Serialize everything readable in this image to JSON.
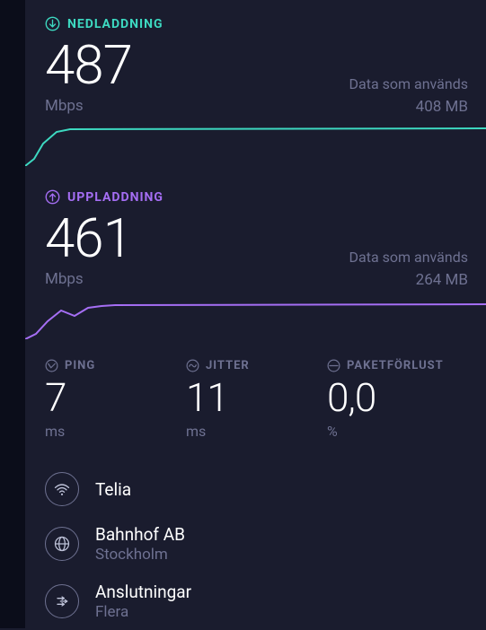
{
  "download": {
    "label": "NEDLADDNING",
    "value": "487",
    "unit": "Mbps",
    "data_used_label": "Data som används",
    "data_used_value": "408 MB"
  },
  "upload": {
    "label": "UPPLADDNING",
    "value": "461",
    "unit": "Mbps",
    "data_used_label": "Data som används",
    "data_used_value": "264 MB"
  },
  "metrics": {
    "ping": {
      "label": "PING",
      "value": "7",
      "unit": "ms"
    },
    "jitter": {
      "label": "JITTER",
      "value": "11",
      "unit": "ms"
    },
    "loss": {
      "label": "PAKETFÖRLUST",
      "value": "0,0",
      "unit": "%"
    }
  },
  "info": {
    "network": {
      "primary": "Telia"
    },
    "isp": {
      "primary": "Bahnhof AB",
      "secondary": "Stockholm"
    },
    "connections": {
      "primary": "Anslutningar",
      "secondary": "Flera"
    }
  },
  "colors": {
    "download": "#3dd9c1",
    "upload": "#a56ef4",
    "muted": "#6e7191"
  },
  "chart_data": [
    {
      "type": "line",
      "title": "Download speed over time",
      "ylabel": "Mbps",
      "ylim": [
        0,
        550
      ],
      "x": [
        0,
        1,
        2,
        3,
        4,
        5,
        6,
        7,
        8,
        9,
        10,
        11,
        12,
        13,
        14,
        15,
        16,
        17,
        18,
        19,
        20
      ],
      "values": [
        0,
        150,
        380,
        470,
        487,
        487,
        488,
        487,
        487,
        487,
        487,
        488,
        487,
        487,
        488,
        487,
        487,
        487,
        488,
        487,
        487
      ]
    },
    {
      "type": "line",
      "title": "Upload speed over time",
      "ylabel": "Mbps",
      "ylim": [
        0,
        550
      ],
      "x": [
        0,
        1,
        2,
        3,
        4,
        5,
        6,
        7,
        8,
        9,
        10,
        11,
        12,
        13,
        14,
        15,
        16,
        17,
        18,
        19,
        20
      ],
      "values": [
        0,
        120,
        300,
        420,
        380,
        440,
        455,
        460,
        461,
        462,
        460,
        461,
        460,
        461,
        462,
        461,
        461,
        462,
        461,
        461,
        461
      ]
    }
  ]
}
